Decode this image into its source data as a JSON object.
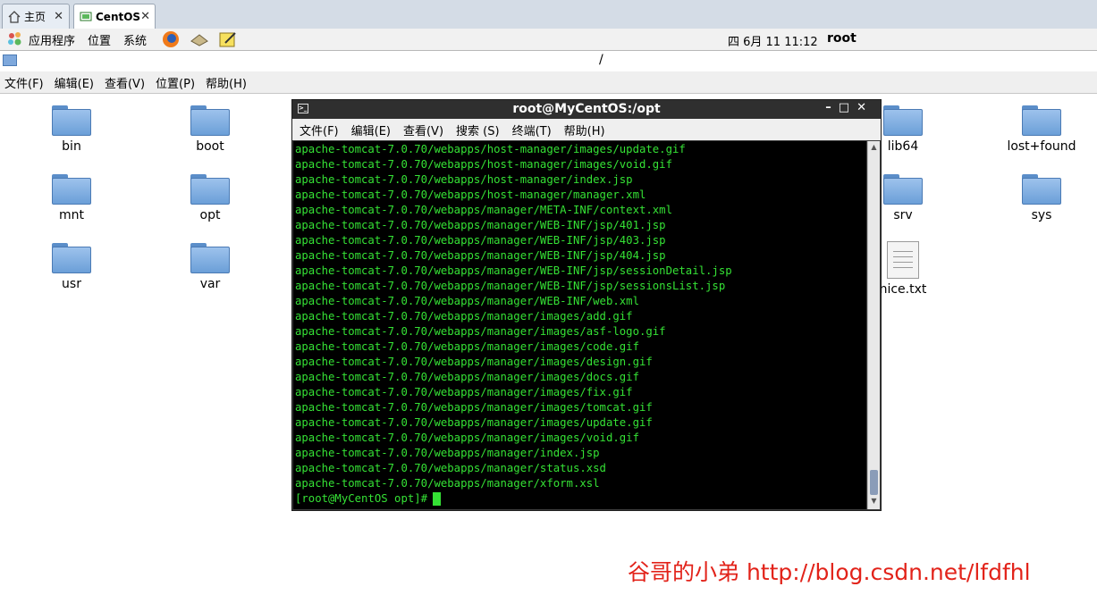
{
  "tabs": [
    {
      "label": "主页",
      "icon": "home-icon"
    },
    {
      "label": "CentOS",
      "icon": "vm-icon"
    }
  ],
  "panel": {
    "menus": [
      "应用程序",
      "位置",
      "系统"
    ],
    "launchers": [
      "firefox-icon",
      "mail-icon",
      "notes-icon"
    ],
    "clock": "四 6月 11 11:12",
    "user": "root"
  },
  "filemanager": {
    "location": "/",
    "menus": [
      "文件(F)",
      "编辑(E)",
      "查看(V)",
      "位置(P)",
      "帮助(H)"
    ],
    "items": [
      "bin",
      "boot",
      "lib64",
      "lost+found",
      "mnt",
      "opt",
      "srv",
      "sys",
      "usr",
      "var",
      "nice.txt"
    ]
  },
  "terminal": {
    "title": "root@MyCentOS:/opt",
    "menus": [
      "文件(F)",
      "编辑(E)",
      "查看(V)",
      "搜索 (S)",
      "终端(T)",
      "帮助(H)"
    ],
    "lines": [
      "apache-tomcat-7.0.70/webapps/host-manager/images/update.gif",
      "apache-tomcat-7.0.70/webapps/host-manager/images/void.gif",
      "apache-tomcat-7.0.70/webapps/host-manager/index.jsp",
      "apache-tomcat-7.0.70/webapps/host-manager/manager.xml",
      "apache-tomcat-7.0.70/webapps/manager/META-INF/context.xml",
      "apache-tomcat-7.0.70/webapps/manager/WEB-INF/jsp/401.jsp",
      "apache-tomcat-7.0.70/webapps/manager/WEB-INF/jsp/403.jsp",
      "apache-tomcat-7.0.70/webapps/manager/WEB-INF/jsp/404.jsp",
      "apache-tomcat-7.0.70/webapps/manager/WEB-INF/jsp/sessionDetail.jsp",
      "apache-tomcat-7.0.70/webapps/manager/WEB-INF/jsp/sessionsList.jsp",
      "apache-tomcat-7.0.70/webapps/manager/WEB-INF/web.xml",
      "apache-tomcat-7.0.70/webapps/manager/images/add.gif",
      "apache-tomcat-7.0.70/webapps/manager/images/asf-logo.gif",
      "apache-tomcat-7.0.70/webapps/manager/images/code.gif",
      "apache-tomcat-7.0.70/webapps/manager/images/design.gif",
      "apache-tomcat-7.0.70/webapps/manager/images/docs.gif",
      "apache-tomcat-7.0.70/webapps/manager/images/fix.gif",
      "apache-tomcat-7.0.70/webapps/manager/images/tomcat.gif",
      "apache-tomcat-7.0.70/webapps/manager/images/update.gif",
      "apache-tomcat-7.0.70/webapps/manager/images/void.gif",
      "apache-tomcat-7.0.70/webapps/manager/index.jsp",
      "apache-tomcat-7.0.70/webapps/manager/status.xsd",
      "apache-tomcat-7.0.70/webapps/manager/xform.xsl"
    ],
    "prompt": "[root@MyCentOS opt]#",
    "text_color": "#35e135"
  },
  "watermark": "谷哥的小弟 http://blog.csdn.net/lfdfhl"
}
